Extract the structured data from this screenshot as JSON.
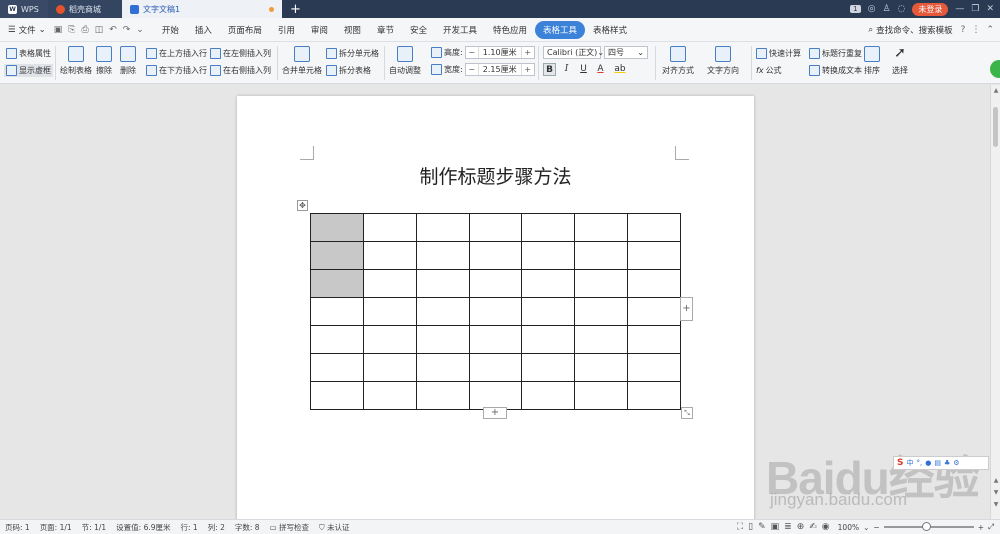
{
  "tabs": {
    "wps": "WPS",
    "store": "稻壳商城",
    "doc": "文字文稿1",
    "new_tab": "+"
  },
  "window": {
    "badge": "1",
    "login": "未登录"
  },
  "menu": {
    "file": "文件",
    "items": [
      "开始",
      "插入",
      "页面布局",
      "引用",
      "审阅",
      "视图",
      "章节",
      "安全",
      "开发工具",
      "特色应用",
      "表格工具",
      "表格样式"
    ],
    "active": "表格工具",
    "search": "查找命令、搜索模板"
  },
  "ribbon": {
    "table_props": "表格属性",
    "show_gridlines": "显示虚框",
    "draw_table": "绘制表格",
    "eraser": "擦除",
    "delete": "删除",
    "insert_above": "在上方插入行",
    "insert_below": "在下方插入行",
    "insert_left": "在左侧插入列",
    "insert_right": "在右侧插入列",
    "merge_cells": "合并单元格",
    "split_cells": "拆分单元格",
    "split_table": "拆分表格",
    "auto_fit": "自动调整",
    "height_label": "高度:",
    "height_value": "1.10厘米",
    "width_label": "宽度:",
    "width_value": "2.15厘米",
    "font_name": "Calibri (正文)",
    "font_size": "四号",
    "bold": "B",
    "italic": "I",
    "underline": "U",
    "font_color": "A",
    "highlight": "ab",
    "align": "对齐方式",
    "text_direction": "文字方向",
    "quick_calc": "快速计算",
    "formula": "公式",
    "repeat_header": "标题行重复",
    "to_text": "转换成文本",
    "sort": "排序",
    "select": "选择"
  },
  "document": {
    "title": "制作标题步骤方法",
    "table": {
      "rows": 7,
      "cols": 7,
      "shaded_cells": [
        [
          0,
          0
        ],
        [
          1,
          0
        ],
        [
          2,
          0
        ]
      ]
    }
  },
  "watermark": {
    "brand": "Baidu经验",
    "url": "jingyan.baidu.com"
  },
  "statusbar": {
    "page_code": "页码: 1",
    "page": "页面: 1/1",
    "section": "节: 1/1",
    "position": "设置值: 6.9厘米",
    "row": "行: 1",
    "col": "列: 2",
    "words": "字数: 8",
    "spell": "拼写检查",
    "cert": "未认证",
    "zoom": "100%",
    "zoom_fraction": 0.47
  }
}
